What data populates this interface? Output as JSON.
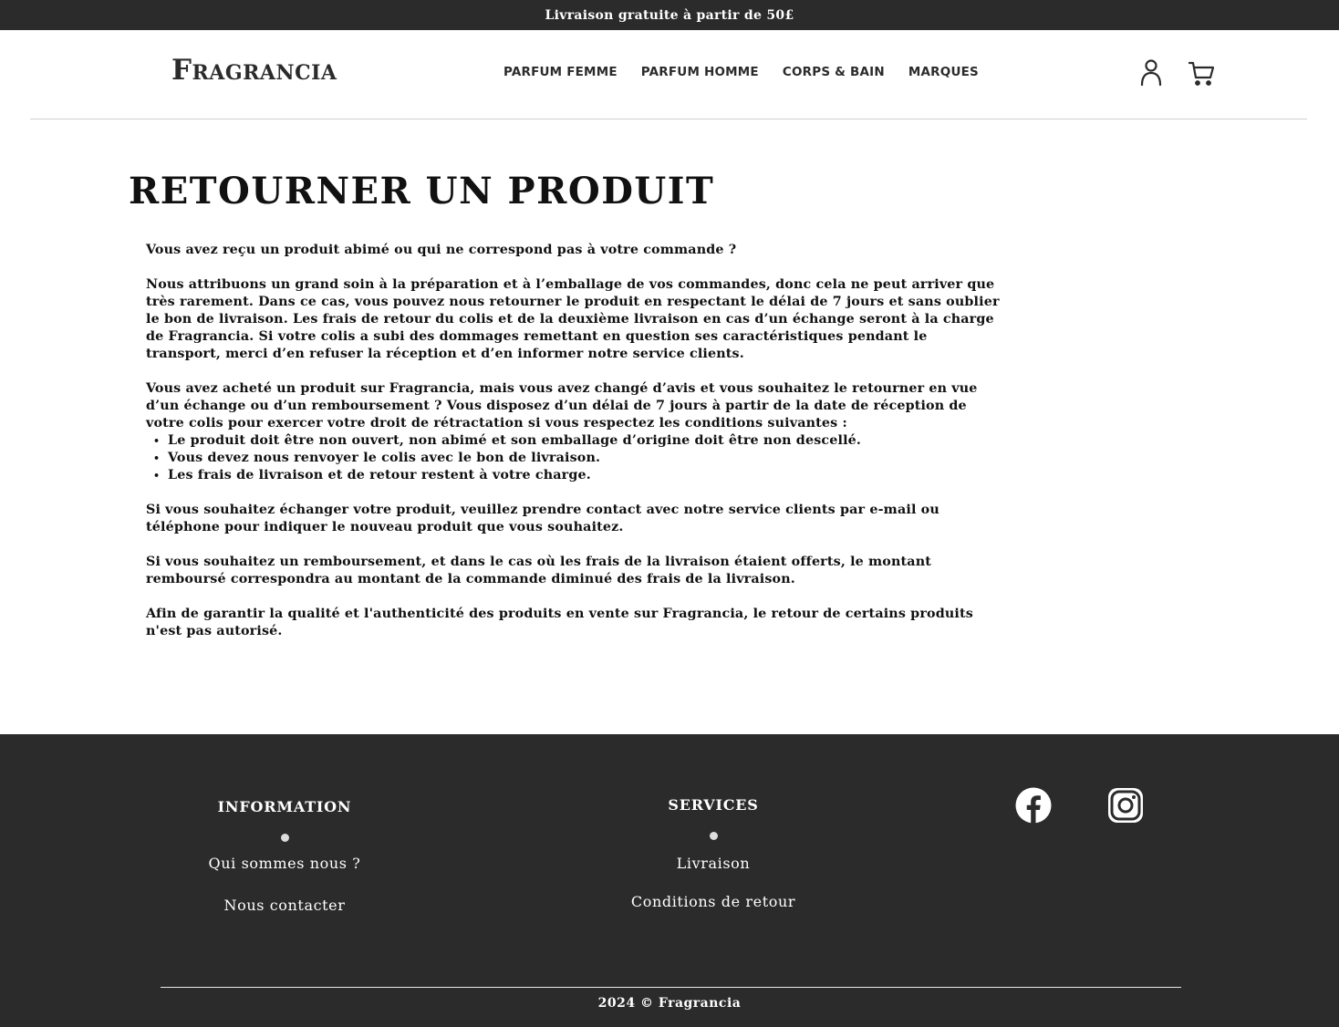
{
  "announcement": "Livraison gratuite à partir de 50£",
  "header": {
    "logo": "Fragrancia",
    "nav": [
      "PARFUM FEMME",
      "PARFUM HOMME",
      "CORPS & BAIN",
      "MARQUES"
    ],
    "icons": [
      "user-icon",
      "cart-icon"
    ]
  },
  "page": {
    "title": "RETOURNER UN PRODUIT",
    "intro": "Vous avez reçu un produit abimé ou qui ne correspond pas à votre commande ?",
    "p1": "Nous attribuons un grand soin à la préparation et à l’emballage de vos commandes, donc cela ne peut arriver que très rarement. Dans ce cas, vous pouvez nous retourner le produit en respectant le délai de 7 jours et sans oublier le bon de livraison. Les frais de retour du colis et de la deuxième livraison en cas d’un échange seront à la charge de Fragrancia. Si votre colis a subi des dommages remettant en question ses caractéristiques pendant le transport, merci d’en refuser la réception et d’en informer notre service clients.",
    "p2": "Vous avez acheté un produit sur Fragrancia, mais vous avez changé d’avis et vous souhaitez le retourner en vue d’un échange ou d’un remboursement ? Vous disposez d’un délai de 7 jours à partir de la date de réception de votre colis pour exercer votre droit de rétractation si vous respectez les conditions suivantes :",
    "conditions": [
      "Le produit doit être non ouvert, non abimé et son emballage d’origine doit être non descellé.",
      "Vous devez nous renvoyer le colis avec le bon de livraison.",
      "Les frais de livraison et de retour restent à votre charge."
    ],
    "p3": "Si vous souhaitez échanger votre produit, veuillez prendre contact avec notre service clients par e-mail ou téléphone pour indiquer le nouveau produit que vous souhaitez.",
    "p4": "Si vous souhaitez un remboursement, et dans le cas où les frais de la livraison étaient offerts, le montant remboursé correspondra au montant de la commande diminué des frais de la livraison.",
    "p5": "Afin de garantir la qualité et l'authenticité des produits en vente sur Fragrancia, le retour de certains produits n'est pas autorisé."
  },
  "footer": {
    "information": {
      "title": "INFORMATION",
      "links": [
        "Qui sommes nous ?",
        "Nous contacter"
      ]
    },
    "services": {
      "title": "SERVICES",
      "links": [
        "Livraison",
        "Conditions de retour"
      ]
    },
    "social": [
      "facebook-icon",
      "instagram-icon"
    ],
    "copyright": "2024 © Fragrancia"
  }
}
